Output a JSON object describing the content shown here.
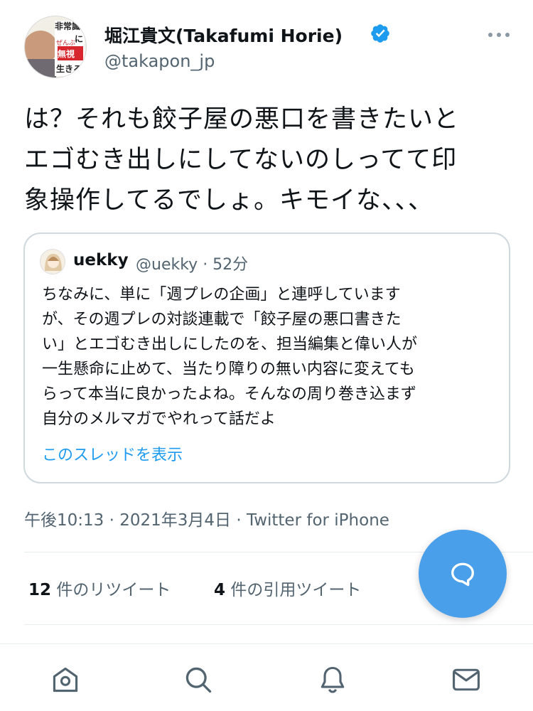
{
  "author": {
    "name": "堀江貴文(Takafumi Horie)",
    "handle": "@takapon_jp",
    "avatar_text": [
      "非常識",
      "に",
      "ぜんぶ",
      "無視",
      "生きろ"
    ]
  },
  "tweet": {
    "lines": [
      "は？それも餃子屋の悪口を書きたいと",
      "エゴむき出しにしてないのしってて印",
      "象操作してるでしょ。キモイな、、、"
    ],
    "timestamp": "午後10:13 · 2021年3月4日 · Twitter for iPhone"
  },
  "quote": {
    "name": "uekky",
    "meta": "@uekky · 52分",
    "lines": [
      "ちなみに、単に「週プレの企画」と連呼しています",
      "が、その週プレの対談連載で「餃子屋の悪口書きた",
      "い」とエゴむき出しにしたのを、担当編集と偉い人が",
      "一生懸命に止めて、当たり障りの無い内容に変えても",
      "らって本当に良かったよね。そんなの周り巻き込まず",
      "自分のメルマガでやれって話だよ"
    ],
    "show_thread": "このスレッドを表示"
  },
  "stats": {
    "retweets_count": "12",
    "retweets_label": " 件のリツイート",
    "quotes_count": "4",
    "quotes_label": " 件の引用ツイート"
  },
  "icons": {
    "verified": "verified-badge-icon",
    "more": "more-dots-icon",
    "compose": "reply-bubble-icon",
    "home": "home-icon",
    "search": "search-icon",
    "notifications": "bell-icon",
    "messages": "envelope-icon"
  },
  "colors": {
    "accent": "#1d9bf0",
    "fab": "#4a9feb",
    "secondary_text": "#536471",
    "primary_text": "#0f1419",
    "border": "#cfd9de"
  }
}
